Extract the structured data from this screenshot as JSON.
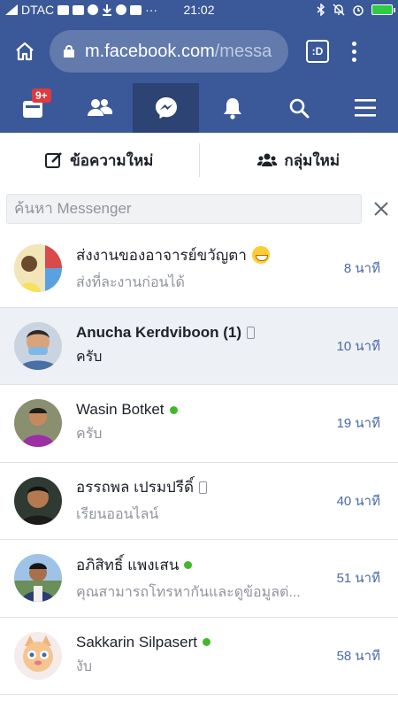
{
  "status_bar": {
    "carrier": "DTAC",
    "time": "21:02",
    "overflow": "···",
    "battery_color": "#2ecc40"
  },
  "browser": {
    "url_domain": "m.facebook.com",
    "url_path": "/messa",
    "tabs_label": ":D"
  },
  "nav": {
    "notification_badge": "9+",
    "items": [
      "home-icon",
      "friends-icon",
      "messenger-icon",
      "bell-icon",
      "search-icon",
      "menu-icon"
    ],
    "active": "messenger-icon"
  },
  "actions": {
    "new_message": "ข้อความใหม่",
    "new_group": "กลุ่มใหม่"
  },
  "search": {
    "placeholder": "ค้นหา Messenger"
  },
  "conversations": [
    {
      "name": "ส่งงานของอาจารย์ขวัญตา",
      "snippet": "ส่งที่ละงานก่อนได้",
      "time": "8 นาที",
      "unread": false,
      "status": "emoji"
    },
    {
      "name": "Anucha Kerdviboon (1)",
      "snippet": "ครับ",
      "time": "10 นาที",
      "unread": true,
      "status": "phone"
    },
    {
      "name": "Wasin Botket",
      "snippet": "ครับ",
      "time": "19 นาที",
      "unread": false,
      "status": "online"
    },
    {
      "name": "อรรถพล เปรมปรีดิ์",
      "snippet": "เรียนออนไลน์",
      "time": "40 นาที",
      "unread": false,
      "status": "phone"
    },
    {
      "name": "อภิสิทธิ์ แพงเสน",
      "snippet": "คุณสามารถโทรหากันและดูข้อมูลต่...",
      "time": "51 นาที",
      "unread": false,
      "status": "online"
    },
    {
      "name": "Sakkarin Silpasert",
      "snippet": "งับ",
      "time": "58 นาที",
      "unread": false,
      "status": "online"
    }
  ],
  "colors": {
    "brand": "#3b5998",
    "timestamp": "#4b6aa8",
    "online": "#42b72a"
  }
}
